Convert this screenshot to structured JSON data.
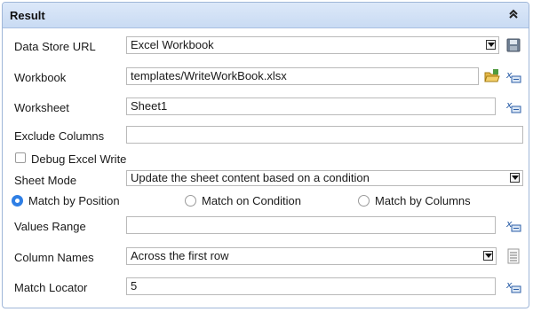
{
  "panel": {
    "title": "Result",
    "collapse_icon": "double-chevron-up-icon"
  },
  "fields": {
    "data_store_url": {
      "label": "Data Store URL",
      "value": "Excel Workbook",
      "icon": "save-icon"
    },
    "workbook": {
      "label": "Workbook",
      "value": "templates/WriteWorkBook.xlsx",
      "icons": [
        "open-folder-icon",
        "expression-icon"
      ]
    },
    "worksheet": {
      "label": "Worksheet",
      "value": "Sheet1",
      "icon": "expression-icon"
    },
    "exclude_columns": {
      "label": "Exclude Columns",
      "value": ""
    },
    "debug_excel_write": {
      "label": "Debug Excel Write",
      "checked": false
    },
    "sheet_mode": {
      "label": "Sheet Mode",
      "value": "Update the sheet content based on a condition"
    },
    "match_mode": {
      "options": [
        "Match by Position",
        "Match on Condition",
        "Match by Columns"
      ],
      "selected": "Match by Position"
    },
    "values_range": {
      "label": "Values Range",
      "value": "",
      "icon": "expression-icon"
    },
    "column_names": {
      "label": "Column Names",
      "value": "Across the first row",
      "icon": "list-icon"
    },
    "match_locator": {
      "label": "Match Locator",
      "value": "5",
      "icon": "expression-icon"
    }
  },
  "colors": {
    "header_bg": "#c9dbf3",
    "border": "#9fb6d8",
    "radio_selected": "#2f7fe5"
  }
}
